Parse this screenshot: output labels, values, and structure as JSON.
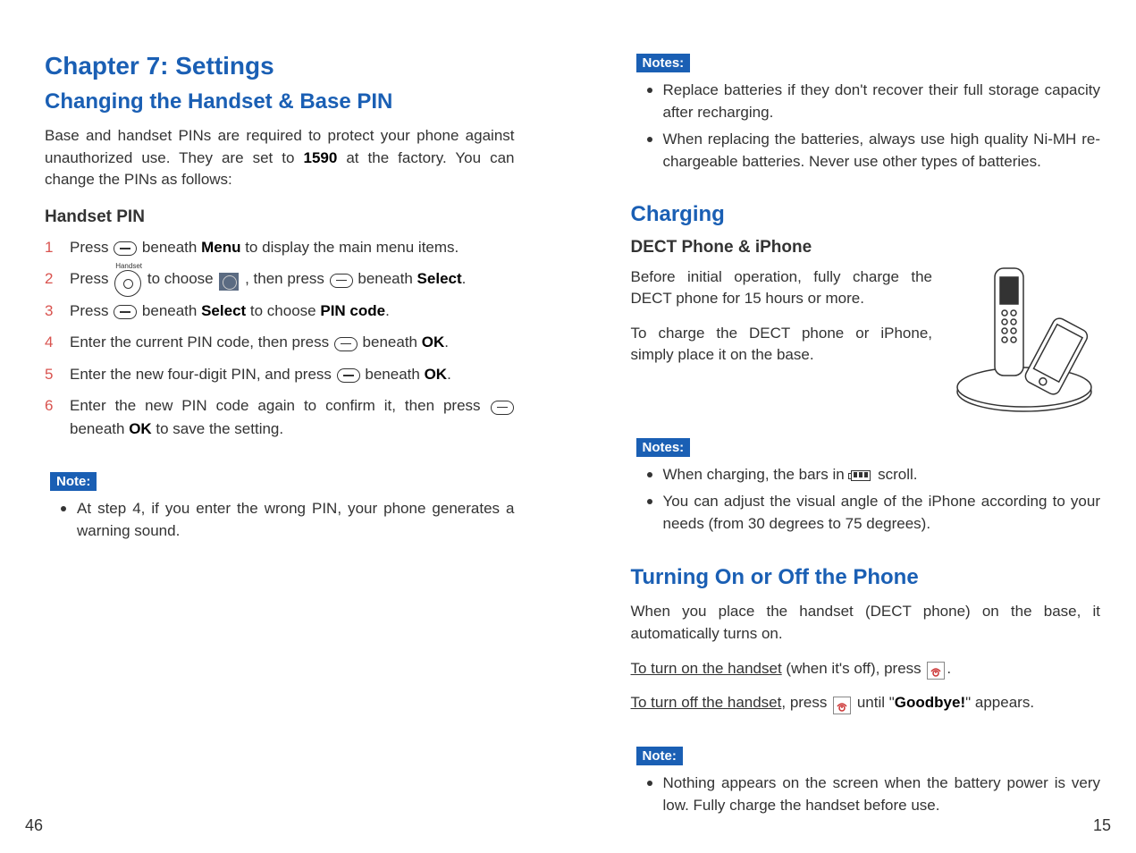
{
  "left": {
    "chapter_title": "Chapter 7: Settings",
    "section_title": "Changing the Handset & Base PIN",
    "intro_a": "Base and handset PINs are required to protect your phone against unauthorized use. They are set to ",
    "intro_pin": "1590",
    "intro_b": " at the factory. You can change the PINs as follows:",
    "sub_heading": "Handset PIN",
    "steps": [
      {
        "n": "1",
        "a": "Press ",
        "b": " beneath ",
        "menu": "Menu",
        "c": " to display the main menu items."
      },
      {
        "n": "2",
        "a": "Press ",
        "b": " to choose ",
        "c": " , then press ",
        "d": " beneath ",
        "sel": "Select",
        "e": "."
      },
      {
        "n": "3",
        "a": "Press ",
        "b": " beneath ",
        "sel": "Select",
        "c": " to choose ",
        "pin": "PIN code",
        "d": "."
      },
      {
        "n": "4",
        "a": "Enter the current PIN code, then press ",
        "b": " beneath ",
        "ok": "OK",
        "c": "."
      },
      {
        "n": "5",
        "a": "Enter the new four-digit PIN, and press ",
        "b": " beneath ",
        "ok": "OK",
        "c": "."
      },
      {
        "n": "6",
        "a": "Enter the new PIN code again to confirm it, then press ",
        "b": " beneath ",
        "ok": "OK",
        "c": " to save the setting."
      }
    ],
    "note_label": "Note:",
    "note_text": "At step 4, if you enter the wrong PIN, your phone generates a warning sound.",
    "page_num": "46"
  },
  "right": {
    "notes_label1": "Notes:",
    "notes1": [
      "Replace batteries if they don't recover their full storage capacity after recharging.",
      "When replacing the batteries, always use high quality Ni-MH re-chargeable batteries. Never use other types of batteries."
    ],
    "charging_title": "Charging",
    "charging_sub": "DECT Phone & iPhone",
    "charge_p1": "Before initial operation, fully charge the DECT phone for 15 hours or more.",
    "charge_p2": "To charge the DECT phone or iPhone, simply place it on the base.",
    "notes_label2": "Notes:",
    "notes2_a": "When charging, the bars in ",
    "notes2_b": " scroll.",
    "notes2_c": "You can adjust the visual angle of the iPhone according to your needs (from 30 degrees to 75 degrees).",
    "turning_title": "Turning On or Off the Phone",
    "turn_intro": "When you place the handset (DECT phone) on the base, it automatically turns on.",
    "turn_on_u": "To turn on the handset",
    "turn_on_b": " (when it's off), press ",
    "turn_on_c": ".",
    "turn_off_u": "To turn off the handset",
    "turn_off_b": ", press ",
    "turn_off_c": " until \"",
    "goodbye": "Goodbye!",
    "turn_off_d": "\" appears.",
    "note_label3": "Note:",
    "note3": "Nothing appears on the screen when the battery power is very low. Fully charge the handset before use.",
    "page_num": "15",
    "nav_label": "Handset"
  }
}
